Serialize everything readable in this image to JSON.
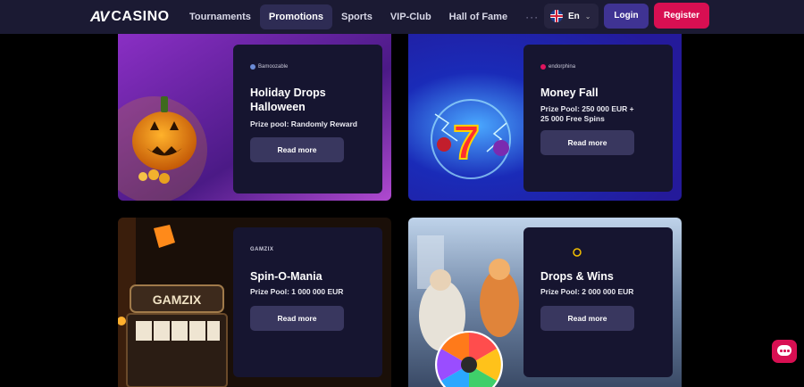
{
  "header": {
    "logo_mark": "AV",
    "logo_text": "CASINO",
    "nav": [
      {
        "label": "Tournaments",
        "active": false
      },
      {
        "label": "Promotions",
        "active": true
      },
      {
        "label": "Sports",
        "active": false
      },
      {
        "label": "VIP-Club",
        "active": false
      },
      {
        "label": "Hall of Fame",
        "active": false
      }
    ],
    "more_label": "···",
    "language": "En",
    "login_label": "Login",
    "register_label": "Register"
  },
  "promotions": [
    {
      "provider": "Bamoozable",
      "title": "Holiday Drops Halloween",
      "pool": "Prize pool: Randomly Reward",
      "cta": "Read more"
    },
    {
      "provider": "endorphina",
      "title": "Money Fall",
      "pool": "Prize Pool: 250 000 EUR + 25 000 Free Spins",
      "cta": "Read more"
    },
    {
      "provider": "GAMZIX",
      "title": "Spin-O-Mania",
      "pool": "Prize Pool: 1 000 000 EUR",
      "cta": "Read more"
    },
    {
      "provider": "",
      "title": "Drops & Wins",
      "pool": "Prize Pool: 2 000 000 EUR",
      "cta": "Read more"
    }
  ],
  "slot_machine_label": "GAMZIX",
  "colors": {
    "brand": "#d80f52",
    "login": "#3f3393",
    "panel": "#161530",
    "button": "#39375f"
  }
}
